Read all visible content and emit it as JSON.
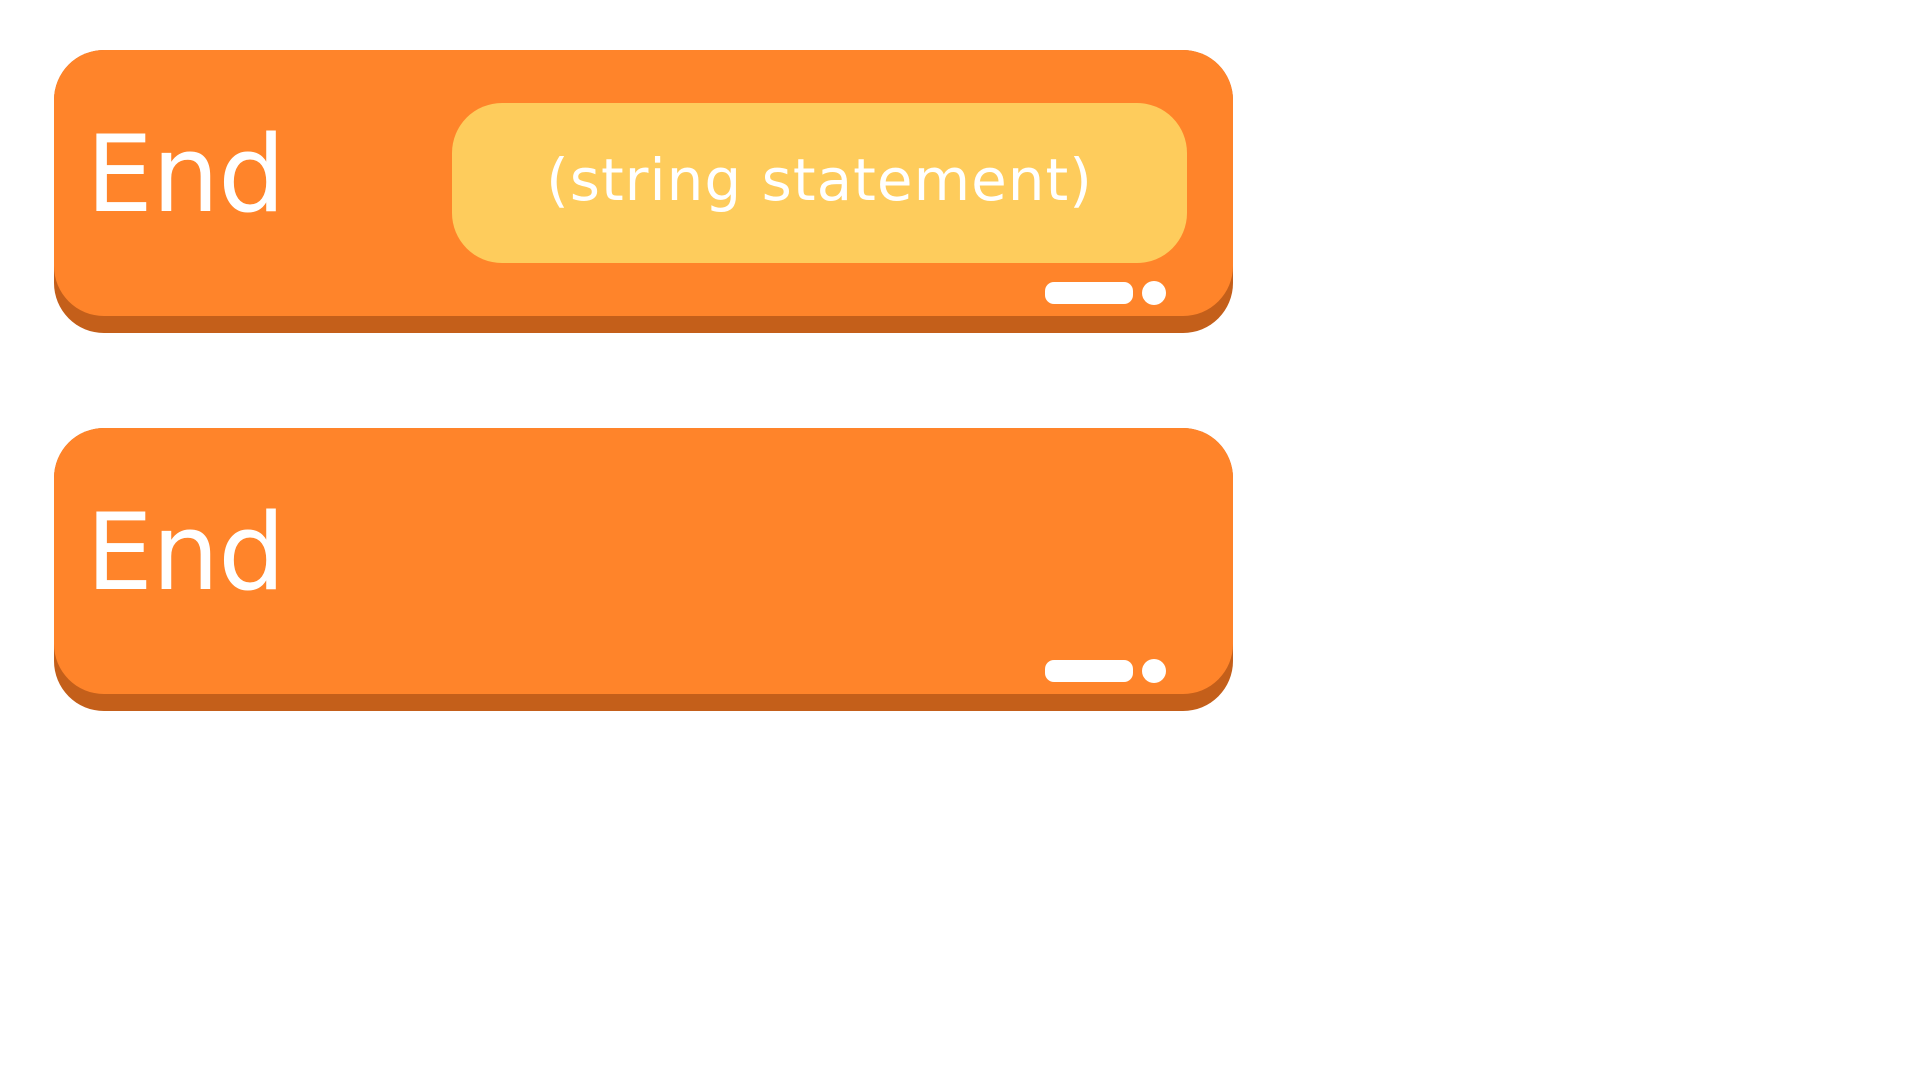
{
  "blocks": [
    {
      "label": "End",
      "input": {
        "value": "(string statement)"
      },
      "color": "#FF842A",
      "shadow_color": "#C45F1A",
      "input_color": "#FECC5C",
      "handle_icon": "drag-handle-icon"
    },
    {
      "label": "End",
      "color": "#FF842A",
      "shadow_color": "#C45F1A",
      "handle_icon": "drag-handle-icon"
    }
  ]
}
